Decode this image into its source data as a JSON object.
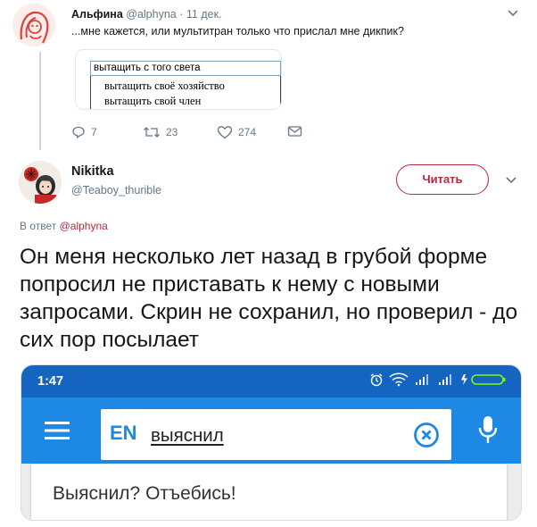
{
  "reply_tweet": {
    "author_name": "Альфина",
    "author_handle": "@alphyna",
    "separator": "·",
    "date": "11 дек.",
    "text": "...мне кажется, или мультитран только что прислал мне дикпик?",
    "image": {
      "input_value": "вытащить с того света",
      "suggestions": [
        "вытащить своё хозяйство",
        "вытащить свой член"
      ]
    },
    "actions": {
      "replies": "7",
      "retweets": "23",
      "likes": "274"
    }
  },
  "main_tweet": {
    "author_name": "Nikitka",
    "author_handle": "@Teaboy_thurible",
    "follow_label": "Читать",
    "reply_prefix": "В ответ",
    "reply_mention": "@alphyna",
    "text": "Он меня несколько лет назад в грубой форме попросил не приставать к нему с новыми запросами. Скрин не сохранил, но проверил - до сих пор посылает",
    "phone_screenshot": {
      "status_time": "1:47",
      "lang_code": "EN",
      "search_query": "выяснил",
      "result_text": "Выяснил? Отъебись!"
    }
  },
  "colors": {
    "accent": "#c0253a",
    "muted_text": "#657786",
    "app_status_bar": "#1565c0",
    "app_bar": "#1e88e5",
    "app_accent": "#1e88e5",
    "battery": "#7cfc00"
  },
  "icons": [
    "reply-icon",
    "retweet-icon",
    "like-icon",
    "dm-icon",
    "chevron-down-icon",
    "menu-icon",
    "clear-icon",
    "mic-icon",
    "alarm-icon",
    "wifi-icon",
    "signal-icon",
    "battery-icon"
  ]
}
